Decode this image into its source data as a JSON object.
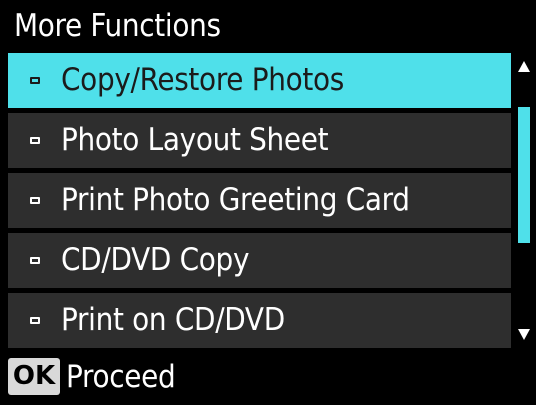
{
  "header": {
    "title": "More Functions"
  },
  "menu": {
    "items": [
      {
        "label": "Copy/Restore Photos",
        "selected": true
      },
      {
        "label": "Photo Layout Sheet",
        "selected": false
      },
      {
        "label": "Print Photo Greeting Card",
        "selected": false
      },
      {
        "label": "CD/DVD Copy",
        "selected": false
      },
      {
        "label": "Print on CD/DVD",
        "selected": false
      }
    ]
  },
  "scrollbar": {
    "up_icon": "triangle-up-icon",
    "down_icon": "triangle-down-icon",
    "thumb_color": "#4fe0ea"
  },
  "footer": {
    "ok_label": "OK",
    "action_label": "Proceed"
  },
  "colors": {
    "background": "#000000",
    "item_background": "#2e2e2e",
    "selected_background": "#4fe0ea",
    "selected_text": "#1b1b1b",
    "text": "#ffffff",
    "ok_badge": "#d9d9d9"
  }
}
